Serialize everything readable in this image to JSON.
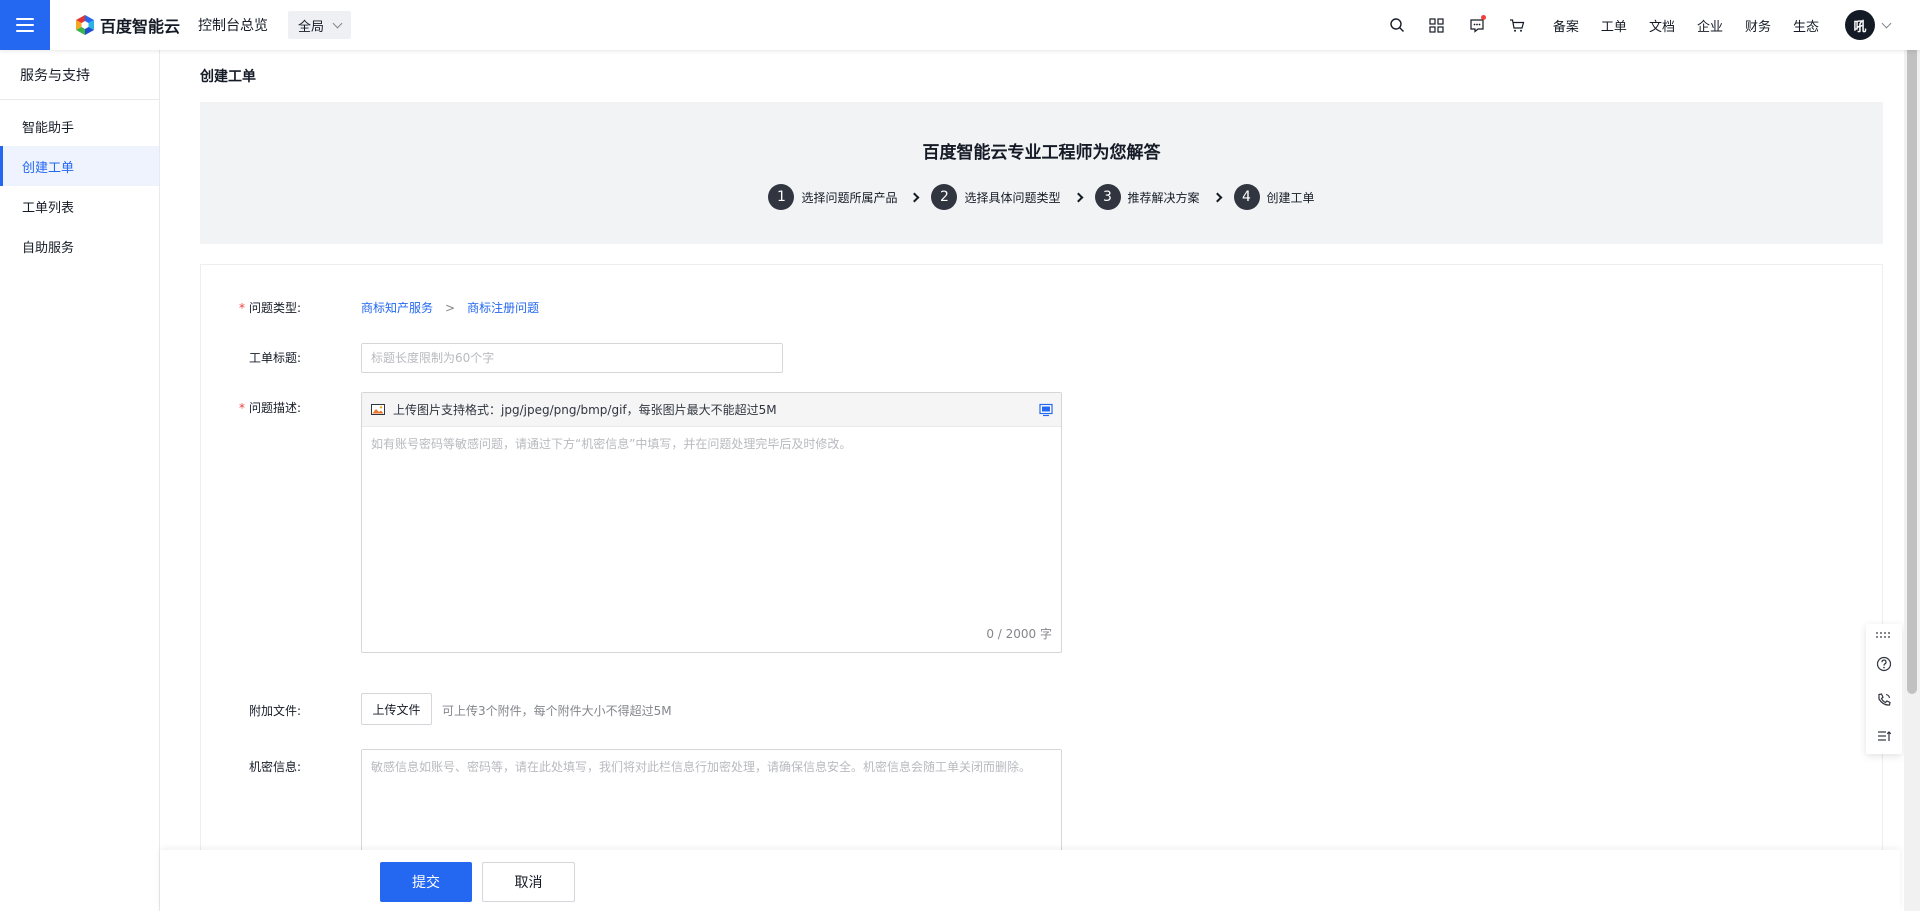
{
  "header": {
    "brand": "百度智能云",
    "console_link": "控制台总览",
    "region": "全局",
    "links": [
      "备案",
      "工单",
      "文档",
      "企业",
      "财务",
      "生态"
    ],
    "avatar_text": "吼"
  },
  "sidebar": {
    "title": "服务与支持",
    "items": [
      {
        "label": "智能助手"
      },
      {
        "label": "创建工单"
      },
      {
        "label": "工单列表"
      },
      {
        "label": "自助服务"
      }
    ]
  },
  "page": {
    "title": "创建工单",
    "banner": {
      "title": "百度智能云专业工程师为您解答",
      "steps": [
        {
          "num": "1",
          "label": "选择问题所属产品"
        },
        {
          "num": "2",
          "label": "选择具体问题类型"
        },
        {
          "num": "3",
          "label": "推荐解决方案"
        },
        {
          "num": "4",
          "label": "创建工单"
        }
      ]
    },
    "form": {
      "issue_type_label": "问题类型:",
      "issue_type_required": "*",
      "category": "商标知产服务",
      "separator": ">",
      "subcategory": "商标注册问题",
      "title_label": "工单标题:",
      "title_placeholder": "标题长度限制为60个字",
      "title_value": "",
      "desc_label": "问题描述:",
      "desc_required": "*",
      "upload_tip": "上传图片支持格式：jpg/jpeg/png/bmp/gif，每张图片最大不能超过5M",
      "desc_placeholder": "如有账号密码等敏感问题，请通过下方“机密信息”中填写，并在问题处理完毕后及时修改。",
      "desc_value": "",
      "char_count": "0 / 2000 字",
      "attach_label": "附加文件:",
      "upload_button": "上传文件",
      "upload_hint": "可上传3个附件，每个附件大小不得超过5M",
      "secret_label": "机密信息:",
      "secret_placeholder": "敏感信息如账号、密码等，请在此处填写，我们将对此栏信息行加密处理，请确保信息安全。机密信息会随工单关闭而删除。",
      "secret_value": ""
    },
    "actions": {
      "submit": "提交",
      "cancel": "取消"
    }
  },
  "colors": {
    "primary": "#2468f2",
    "required": "#f33e3e",
    "step_circle": "#303540",
    "banner_bg": "#f2f3f5"
  },
  "icons": {
    "menu": "hamburger-icon",
    "search": "search-icon",
    "apps": "grid-icon",
    "messages": "message-icon",
    "cart": "cart-icon",
    "help": "question-icon",
    "phone": "phone-icon",
    "feedback": "list-icon"
  }
}
